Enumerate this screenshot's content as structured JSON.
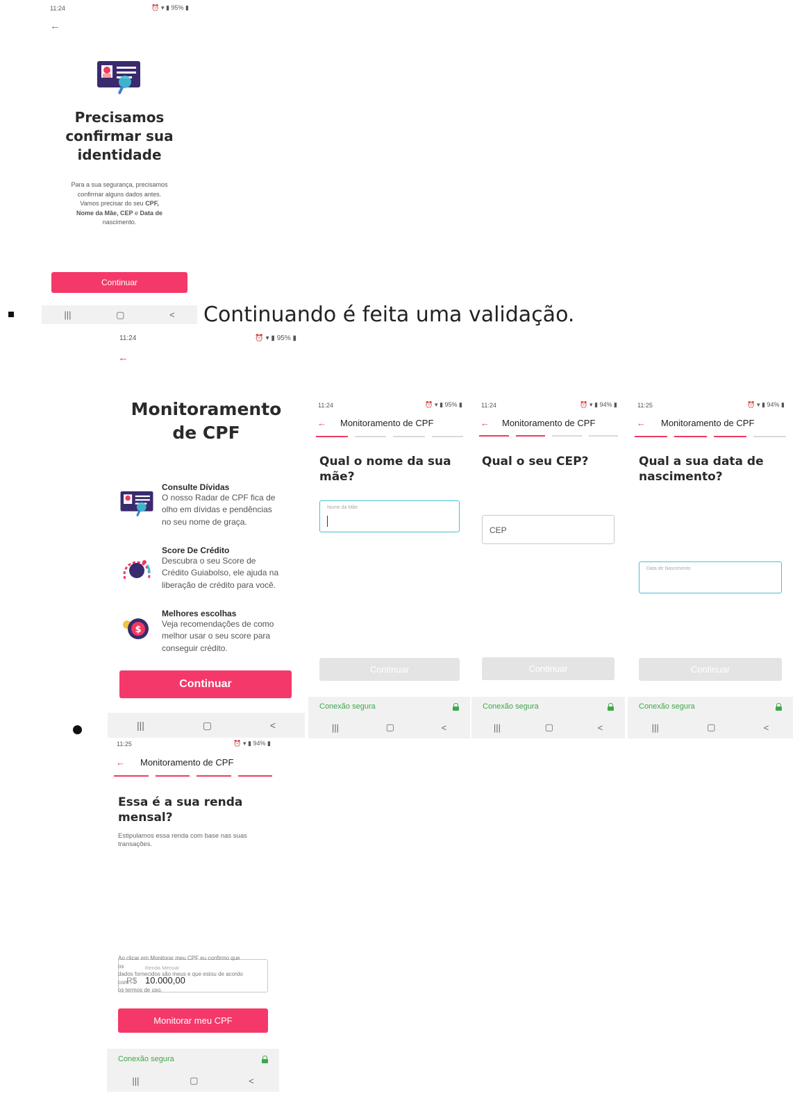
{
  "common": {
    "back_arrow": "←",
    "header_title": "Monitoramento de CPF",
    "secure_label": "Conexão segura",
    "nav_recent": "|||",
    "nav_home": "▢",
    "nav_back": "<",
    "continue_label": "Continuar"
  },
  "screen1": {
    "time": "11:24",
    "battery": "95%",
    "title_line1": "Precisamos",
    "title_line2": "confirmar sua",
    "title_line3": "identidade",
    "body_line1": "Para a sua segurança, precisamos",
    "body_line2": "confirmar alguns dados antes.",
    "body_line3": "Vamos precisar do seu",
    "body_bold1": "CPF,",
    "body_bold2": "Nome da Mãe, CEP",
    "body_line4": "e",
    "body_bold3": "Data de",
    "body_bold4": "nascimento."
  },
  "note": {
    "text": "Continuando é feita uma validação."
  },
  "screen2": {
    "time": "11:24",
    "battery": "95%",
    "title_line1": "Monitoramento",
    "title_line2": "de CPF",
    "features": [
      {
        "title": "Consulte Dívidas",
        "desc1": "O nosso Radar de CPF fica de",
        "desc2": "olho em dívidas e pendências",
        "desc3": "no seu nome de graça."
      },
      {
        "title": "Score De Crédito",
        "desc1": "Descubra o seu Score de",
        "desc2": "Crédito Guiabolso, ele ajuda na",
        "desc3": "liberação de crédito para você."
      },
      {
        "title": "Melhores escolhas",
        "desc1": "Veja recomendações de como",
        "desc2": "melhor usar o seu score para",
        "desc3": "conseguir crédito."
      }
    ]
  },
  "screen3": {
    "time": "11:24",
    "battery": "95%",
    "question_line1": "Qual o nome da sua",
    "question_line2": "mãe?",
    "field_label": "Nome da Mãe"
  },
  "screen4": {
    "time": "11:24",
    "battery": "94%",
    "question": "Qual o seu CEP?",
    "field_placeholder": "CEP"
  },
  "screen5": {
    "time": "11:25",
    "battery": "94%",
    "question_line1": "Qual a sua data de",
    "question_line2": "nascimento?",
    "field_label": "Data de Nascimento"
  },
  "screen6": {
    "time": "11:25",
    "battery": "94%",
    "question_line1": "Essa é a sua renda",
    "question_line2": "mensal?",
    "subtitle_line1": "Estipulamos essa renda com base nas suas",
    "subtitle_line2": "transações.",
    "field_label": "Renda Mensal",
    "currency": "R$",
    "value": "10.000,00",
    "terms_line1": "Ao clicar em Monitorar meu CPF eu confirmo que",
    "terms_line2": "os",
    "terms_line3": "dados fornecidos são meus e que estou de acordo",
    "terms_line4": "com",
    "terms_line5": "os termos de uso.",
    "button_label": "Monitorar meu CPF"
  }
}
